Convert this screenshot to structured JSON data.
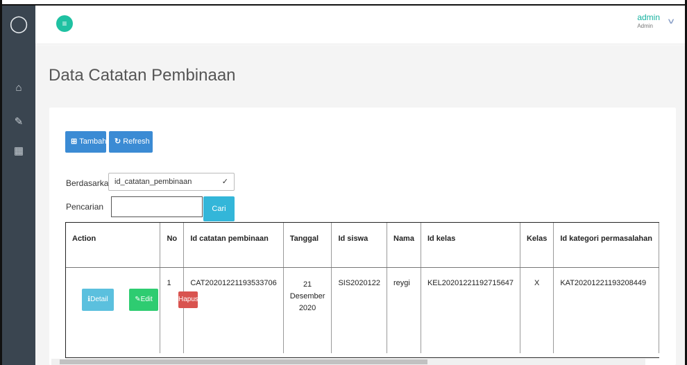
{
  "header": {
    "user_name": "admin",
    "user_role": "Admin"
  },
  "page": {
    "title": "Data Catatan Pembinaan"
  },
  "toolbar": {
    "tambah_label": "Tambah",
    "refresh_label": "Refresh"
  },
  "filter": {
    "by_label": "Berdasarkan:",
    "by_selected": "id_catatan_pembinaan",
    "search_label": "Pencarian",
    "search_colon": ":",
    "search_value": "",
    "search_button": "Cari"
  },
  "table": {
    "headers": [
      "Action",
      "No",
      "Id catatan pembinaan",
      "Tanggal",
      "Id siswa",
      "Nama",
      "Id kelas",
      "Kelas",
      "Id kategori permasalahan"
    ],
    "rows": [
      {
        "actions": {
          "detail": "Detail",
          "edit": "Edit",
          "hapus": "Hapus"
        },
        "no": "1",
        "id_catatan": "CAT20201221193533706",
        "tanggal_day": "21",
        "tanggal_month": "Desember",
        "tanggal_year": "2020",
        "id_siswa": "SIS2020122",
        "nama": "reygi",
        "id_kelas": "KEL20201221192715647",
        "kelas": "X",
        "id_kategori": "KAT20201221193208449"
      }
    ]
  },
  "icons": {
    "sidebar": [
      "user-icon",
      "home-icon",
      "edit-icon",
      "calendar-icon"
    ],
    "menu": "menu-icon",
    "chevron": "chevron-down-icon"
  },
  "colors": {
    "accent": "#1fc1a2",
    "primary": "#3b8bd4",
    "info": "#5bc0de",
    "success": "#2ecc71",
    "danger": "#d9534f",
    "sidebar": "#3a4550"
  }
}
